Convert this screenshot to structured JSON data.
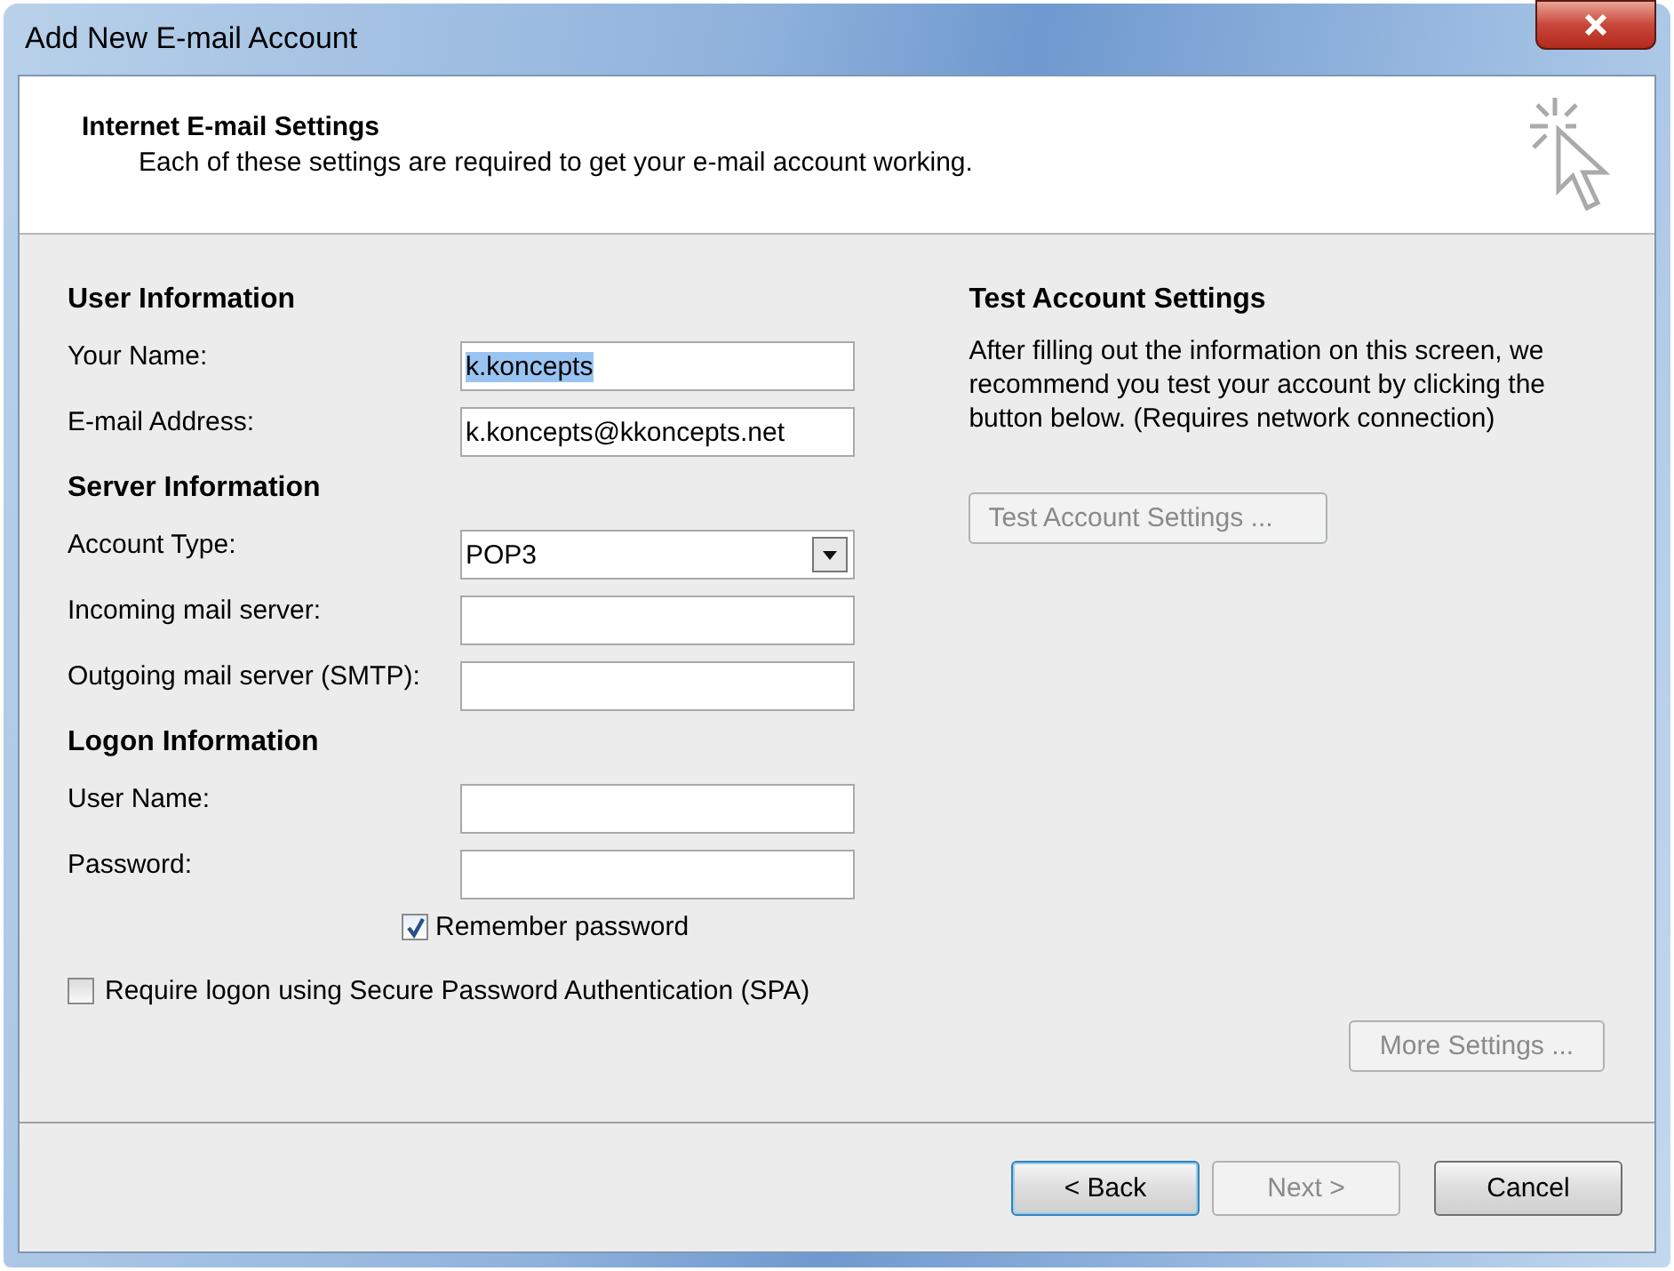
{
  "window": {
    "title": "Add New E-mail Account"
  },
  "header": {
    "title": "Internet E-mail Settings",
    "subtitle": "Each of these settings are required to get your e-mail account working."
  },
  "sections": [
    {
      "heading": "User Information",
      "fields": [
        {
          "label": "Your Name:",
          "kind": "text",
          "value": "k.koncepts",
          "selected": true
        },
        {
          "label": "E-mail Address:",
          "kind": "text",
          "value": "k.koncepts@kkoncepts.net",
          "selected": false
        }
      ]
    },
    {
      "heading": "Server Information",
      "fields": [
        {
          "label": "Account Type:",
          "kind": "dropdown",
          "value": "POP3",
          "selected": false
        },
        {
          "label": "Incoming mail server:",
          "kind": "text"
        },
        {
          "label": "Outgoing mail server (SMTP):",
          "kind": "text"
        }
      ]
    },
    {
      "heading": "Logon Information",
      "fields": [
        {
          "label": "User Name:",
          "kind": "text"
        },
        {
          "label": "Password:",
          "kind": "text"
        }
      ]
    }
  ],
  "remember_password": {
    "label": "Remember password",
    "checked": true
  },
  "spa": {
    "label": "Require logon using Secure Password Authentication (SPA)",
    "checked": false
  },
  "test": {
    "heading": "Test Account Settings",
    "text": "After filling out the information on this screen, we recommend you test your account by clicking the button below. (Requires network connection)",
    "button": {
      "label": "Test Account Settings ...",
      "disabled": true
    }
  },
  "more_settings": {
    "label": "More Settings ...",
    "disabled": true
  },
  "buttons": [
    {
      "label": "< Back",
      "disabled": false,
      "default": true
    },
    {
      "label": "Next >",
      "disabled": true,
      "default": false
    },
    {
      "label": "Cancel",
      "disabled": false,
      "default": false
    }
  ]
}
